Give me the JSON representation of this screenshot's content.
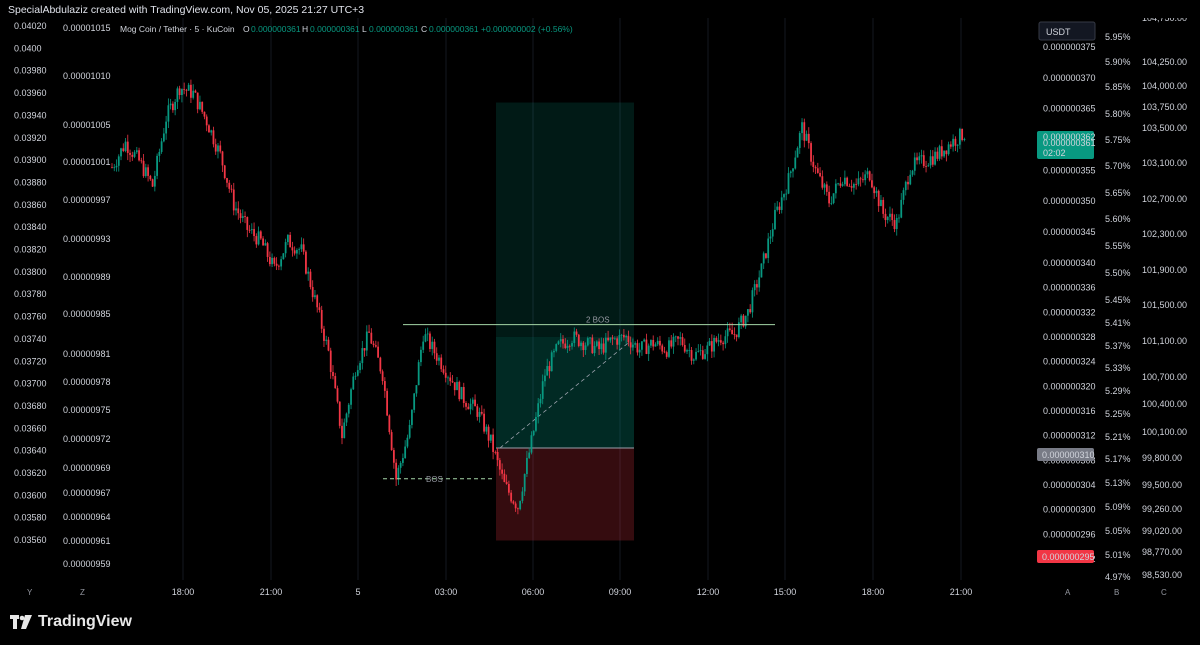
{
  "header": {
    "caption": "SpecialAbdulaziz created with TradingView.com, Nov 05, 2025 21:27 UTC+3"
  },
  "legend": {
    "symbol": "Mog Coin / Tether · 5 · KuCoin",
    "o_label": "O",
    "o_value": "0.000000361",
    "h_label": "H",
    "h_value": "0.000000361",
    "l_label": "L",
    "l_value": "0.000000361",
    "c_label": "C",
    "c_value": "0.000000361",
    "change": "+0.000000002 (+0.56%)"
  },
  "currency_badge": "USDT",
  "left_axis_1": [
    "0.04020",
    "0.0400",
    "0.03980",
    "0.03960",
    "0.03940",
    "0.03920",
    "0.03900",
    "0.03880",
    "0.03860",
    "0.03840",
    "0.03820",
    "0.03800",
    "0.03780",
    "0.03760",
    "0.03740",
    "0.03720",
    "0.03700",
    "0.03680",
    "0.03660",
    "0.03640",
    "0.03620",
    "0.03600",
    "0.03580",
    "0.03560"
  ],
  "left_axis_2": [
    "0.00001015",
    "0.00001010",
    "0.00001005",
    "0.00001001",
    "0.00000997",
    "0.00000993",
    "0.00000989",
    "0.00000985",
    "0.00000981",
    "0.00000978",
    "0.00000975",
    "0.00000972",
    "0.00000969",
    "0.00000967",
    "0.00000964",
    "0.00000961",
    "0.00000959"
  ],
  "right_axis_price": [
    "0.000000375",
    "0.000000370",
    "0.000000365",
    "0.000000361",
    "0.000000355",
    "0.000000350",
    "0.000000345",
    "0.000000340",
    "0.000000336",
    "0.000000332",
    "0.000000328",
    "0.000000324",
    "0.000000320",
    "0.000000316",
    "0.000000312",
    "0.000000308",
    "0.000000304",
    "0.000000300",
    "0.000000296",
    "0.000000292"
  ],
  "right_axis_pct": [
    "5.95%",
    "5.90%",
    "5.85%",
    "5.80%",
    "5.75%",
    "5.70%",
    "5.65%",
    "5.60%",
    "5.55%",
    "5.50%",
    "5.45%",
    "5.41%",
    "5.37%",
    "5.33%",
    "5.29%",
    "5.25%",
    "5.21%",
    "5.17%",
    "5.13%",
    "5.09%",
    "5.05%",
    "5.01%",
    "4.97%"
  ],
  "right_axis_3": [
    "104,750.00",
    "104,250.00",
    "104,000.00",
    "103,750.00",
    "103,500.00",
    "103,100.00",
    "102,700.00",
    "102,300.00",
    "101,900.00",
    "101,500.00",
    "101,100.00",
    "100,700.00",
    "100,400.00",
    "100,100.00",
    "99,800.00",
    "99,500.00",
    "99,260.00",
    "99,020.00",
    "98,770.00",
    "98,530.00"
  ],
  "price_tags": {
    "current": "0.000000362",
    "current_hidden": "0.000000361",
    "countdown": "02:02",
    "gray": "0.000000310",
    "red": "0.000000295",
    "green_color": "#089981",
    "gray_color": "#787b86",
    "red_color": "#f23645"
  },
  "time_axis": [
    "18:00",
    "21:00",
    "5",
    "03:00",
    "06:00",
    "09:00",
    "12:00",
    "15:00",
    "18:00",
    "21:00"
  ],
  "axis_corner_left": [
    "Y",
    "Z"
  ],
  "axis_corner_right": [
    "A",
    "B",
    "C"
  ],
  "annotations": {
    "bos": "BOS",
    "bos2": "2 BOS"
  },
  "chart_data": {
    "type": "candlestick",
    "symbol": "MOGUSDT",
    "interval": "5",
    "ylim": [
      2.9e-07,
      3.79e-07
    ],
    "up_color": "#089981",
    "down_color": "#f23645",
    "key_prices": {
      "open": 3.61e-07,
      "high": 3.61e-07,
      "low": 3.61e-07,
      "close": 3.61e-07,
      "last": 3.62e-07
    },
    "path": [
      [
        0,
        3.555e-07
      ],
      [
        6,
        3.595e-07
      ],
      [
        12,
        3.565e-07
      ],
      [
        18,
        3.525e-07
      ],
      [
        24,
        3.635e-07
      ],
      [
        30,
        3.685e-07
      ],
      [
        36,
        3.675e-07
      ],
      [
        42,
        3.63e-07
      ],
      [
        48,
        3.575e-07
      ],
      [
        54,
        3.495e-07
      ],
      [
        60,
        3.455e-07
      ],
      [
        66,
        3.435e-07
      ],
      [
        72,
        3.39e-07
      ],
      [
        78,
        3.435e-07
      ],
      [
        84,
        3.42e-07
      ],
      [
        90,
        3.34e-07
      ],
      [
        96,
        3.255e-07
      ],
      [
        102,
        3.12e-07
      ],
      [
        108,
        3.23e-07
      ],
      [
        114,
        3.285e-07
      ],
      [
        120,
        3.22e-07
      ],
      [
        126,
        3.05e-07
      ],
      [
        132,
        3.13e-07
      ],
      [
        138,
        3.285e-07
      ],
      [
        144,
        3.25e-07
      ],
      [
        150,
        3.215e-07
      ],
      [
        156,
        3.18e-07
      ],
      [
        162,
        3.16e-07
      ],
      [
        168,
        3.11e-07
      ],
      [
        174,
        3.04e-07
      ],
      [
        180,
        3.005e-07
      ],
      [
        186,
        3.11e-07
      ],
      [
        192,
        3.22e-07
      ],
      [
        198,
        3.265e-07
      ],
      [
        204,
        3.28e-07
      ],
      [
        210,
        3.27e-07
      ],
      [
        216,
        3.26e-07
      ],
      [
        222,
        3.275e-07
      ],
      [
        228,
        3.28e-07
      ],
      [
        234,
        3.26e-07
      ],
      [
        240,
        3.27e-07
      ],
      [
        246,
        3.26e-07
      ],
      [
        252,
        3.275e-07
      ],
      [
        258,
        3.25e-07
      ],
      [
        264,
        3.26e-07
      ],
      [
        270,
        3.28e-07
      ],
      [
        276,
        3.285e-07
      ],
      [
        282,
        3.32e-07
      ],
      [
        288,
        3.39e-07
      ],
      [
        294,
        3.475e-07
      ],
      [
        300,
        3.535e-07
      ],
      [
        306,
        3.62e-07
      ],
      [
        312,
        3.55e-07
      ],
      [
        318,
        3.5e-07
      ],
      [
        324,
        3.54e-07
      ],
      [
        330,
        3.525e-07
      ],
      [
        336,
        3.545e-07
      ],
      [
        342,
        3.48e-07
      ],
      [
        348,
        3.465e-07
      ],
      [
        354,
        3.555e-07
      ],
      [
        360,
        3.565e-07
      ],
      [
        366,
        3.575e-07
      ],
      [
        372,
        3.595e-07
      ],
      [
        378,
        3.61e-07
      ]
    ],
    "long_position": {
      "entry_price": 3.1e-07,
      "target_price": 3.66e-07,
      "stop_price": 2.95e-07,
      "trend_end_price": 3.27e-07
    },
    "bos_levels": [
      {
        "label": "BOS",
        "price": 3.05e-07
      },
      {
        "label": "2 BOS",
        "price": 3.3e-07
      }
    ]
  }
}
